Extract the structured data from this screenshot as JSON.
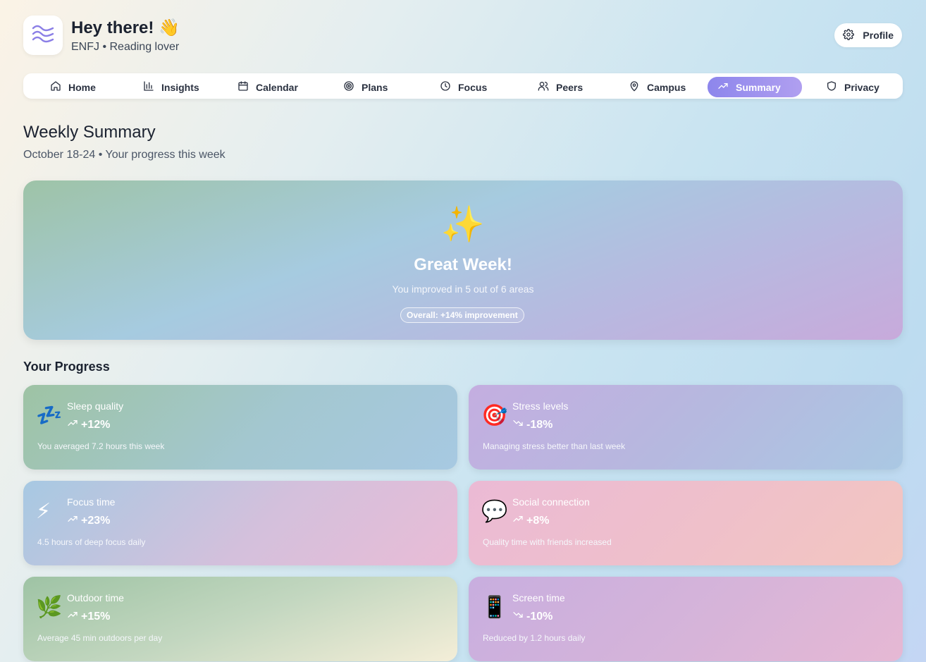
{
  "header": {
    "greeting": "Hey there! 👋",
    "subtitle": "ENFJ • Reading lover",
    "profile_label": "Profile"
  },
  "nav": [
    {
      "label": "Home",
      "icon": "home-icon"
    },
    {
      "label": "Insights",
      "icon": "bar-chart-icon"
    },
    {
      "label": "Calendar",
      "icon": "calendar-icon"
    },
    {
      "label": "Plans",
      "icon": "target-icon"
    },
    {
      "label": "Focus",
      "icon": "clock-icon"
    },
    {
      "label": "Peers",
      "icon": "users-icon"
    },
    {
      "label": "Campus",
      "icon": "map-pin-icon"
    },
    {
      "label": "Summary",
      "icon": "trending-up-icon",
      "active": true
    },
    {
      "label": "Privacy",
      "icon": "shield-icon"
    }
  ],
  "page": {
    "title": "Weekly Summary",
    "subtitle": "October 18-24 • Your progress this week"
  },
  "hero": {
    "emoji": "✨",
    "title": "Great Week!",
    "subtitle": "You improved in 5 out of 6 areas",
    "pill": "Overall: +14% improvement"
  },
  "progress": {
    "title": "Your Progress",
    "cards": [
      {
        "emoji": "💤",
        "label": "Sleep quality",
        "value": "+12%",
        "trend": "up",
        "desc": "You averaged 7.2 hours this week"
      },
      {
        "emoji": "🎯",
        "label": "Stress levels",
        "value": "-18%",
        "trend": "down",
        "desc": "Managing stress better than last week"
      },
      {
        "emoji": "⚡",
        "label": "Focus time",
        "value": "+23%",
        "trend": "up",
        "desc": "4.5 hours of deep focus daily"
      },
      {
        "emoji": "💬",
        "label": "Social connection",
        "value": "+8%",
        "trend": "up",
        "desc": "Quality time with friends increased"
      },
      {
        "emoji": "🌿",
        "label": "Outdoor time",
        "value": "+15%",
        "trend": "up",
        "desc": "Average 45 min outdoors per day"
      },
      {
        "emoji": "📱",
        "label": "Screen time",
        "value": "-10%",
        "trend": "down",
        "desc": "Reduced by 1.2 hours daily"
      }
    ]
  },
  "colors": {
    "accent": "#8d86ec",
    "text": "#1b2230"
  }
}
